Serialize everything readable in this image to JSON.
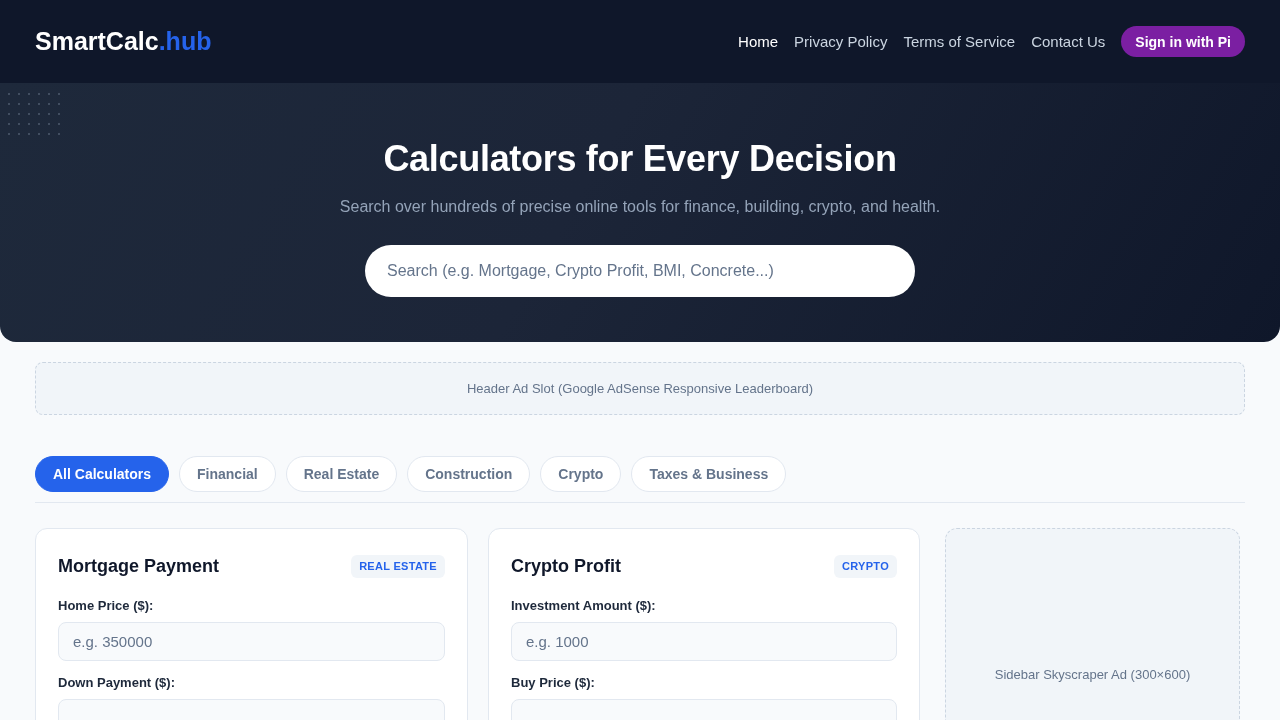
{
  "header": {
    "logo": {
      "main": "SmartCalc",
      "accent": ".hub"
    },
    "nav": [
      {
        "label": "Home",
        "selected": true
      },
      {
        "label": "Privacy Policy",
        "selected": false
      },
      {
        "label": "Terms of Service",
        "selected": false
      },
      {
        "label": "Contact Us",
        "selected": false
      }
    ],
    "sign_in_button": "Sign in with Pi"
  },
  "hero": {
    "title": "Calculators for Every Decision",
    "subtitle": "Search over hundreds of precise online tools for finance, building, crypto, and health.",
    "search": {
      "placeholder": "Search (e.g. Mortgage, Crypto Profit, BMI, Concrete...)"
    }
  },
  "header_ad": "Header Ad Slot (Google AdSense Responsive Leaderboard)",
  "category_tabs": [
    {
      "label": "All Calculators",
      "selected": true
    },
    {
      "label": "Financial",
      "selected": false
    },
    {
      "label": "Real Estate",
      "selected": false
    },
    {
      "label": "Construction",
      "selected": false
    },
    {
      "label": "Crypto",
      "selected": false
    },
    {
      "label": "Taxes & Business",
      "selected": false
    }
  ],
  "calculators": [
    {
      "title": "Mortgage Payment",
      "badge": "REAL ESTATE",
      "fields": [
        {
          "label": "Home Price ($):",
          "placeholder": "e.g. 350000"
        },
        {
          "label": "Down Payment ($):"
        }
      ]
    },
    {
      "title": "Crypto Profit",
      "badge": "CRYPTO",
      "fields": [
        {
          "label": "Investment Amount ($):",
          "placeholder": "e.g. 1000"
        },
        {
          "label": "Buy Price ($):"
        }
      ]
    }
  ],
  "sidebar_ad": "Sidebar Skyscraper Ad (300×600)"
}
